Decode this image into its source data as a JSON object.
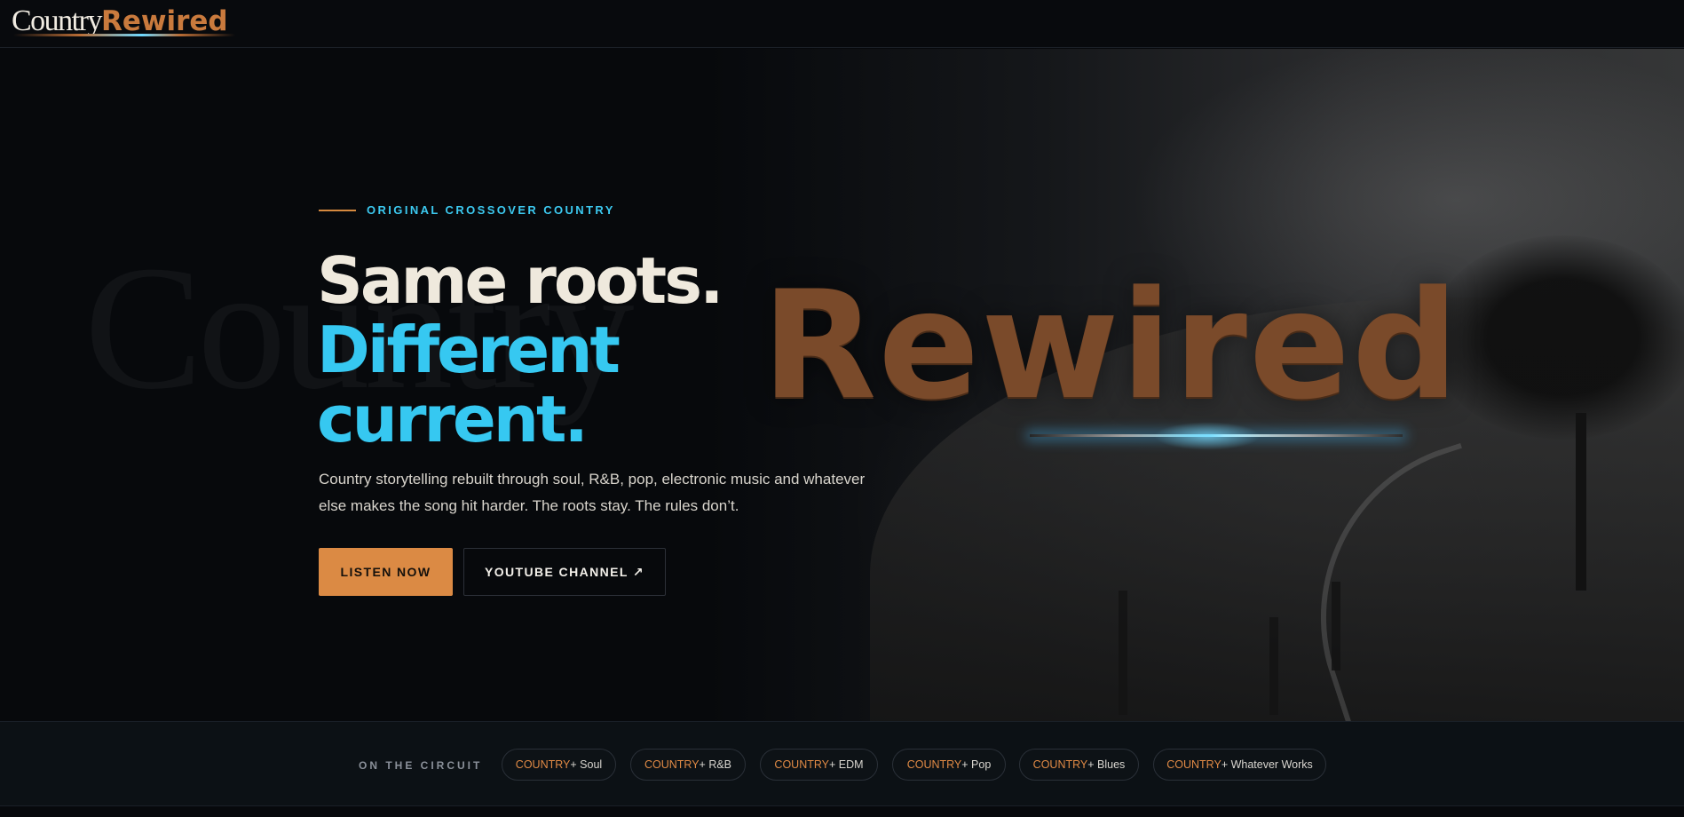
{
  "header": {
    "logo": {
      "country": "Country",
      "rewired": "Rewired"
    }
  },
  "hero": {
    "eyebrow": "ORIGINAL CROSSOVER COUNTRY",
    "headline_line1": "Same roots.",
    "headline_line2": "Different",
    "headline_line3": "current.",
    "lede": "Country storytelling rebuilt through soul, R&B, pop, electronic music and whatever else makes the song hit harder. The roots stay. The rules don’t.",
    "background_wordmark": {
      "country": "Country",
      "rewired": "Rewired"
    },
    "buttons": {
      "primary": "LISTEN NOW",
      "secondary": "YOUTUBE CHANNEL ↗"
    }
  },
  "circuit": {
    "label": "ON THE CIRCUIT",
    "chips": [
      {
        "prefix": "COUNTRY",
        "suffix": " + Soul"
      },
      {
        "prefix": "COUNTRY",
        "suffix": " + R&B"
      },
      {
        "prefix": "COUNTRY",
        "suffix": " + EDM"
      },
      {
        "prefix": "COUNTRY",
        "suffix": " + Pop"
      },
      {
        "prefix": "COUNTRY",
        "suffix": " + Blues"
      },
      {
        "prefix": "COUNTRY",
        "suffix": " + Whatever Works"
      }
    ]
  },
  "colors": {
    "accent_orange": "#db8a44",
    "accent_blue": "#36c8f1",
    "background": "#07090c"
  }
}
